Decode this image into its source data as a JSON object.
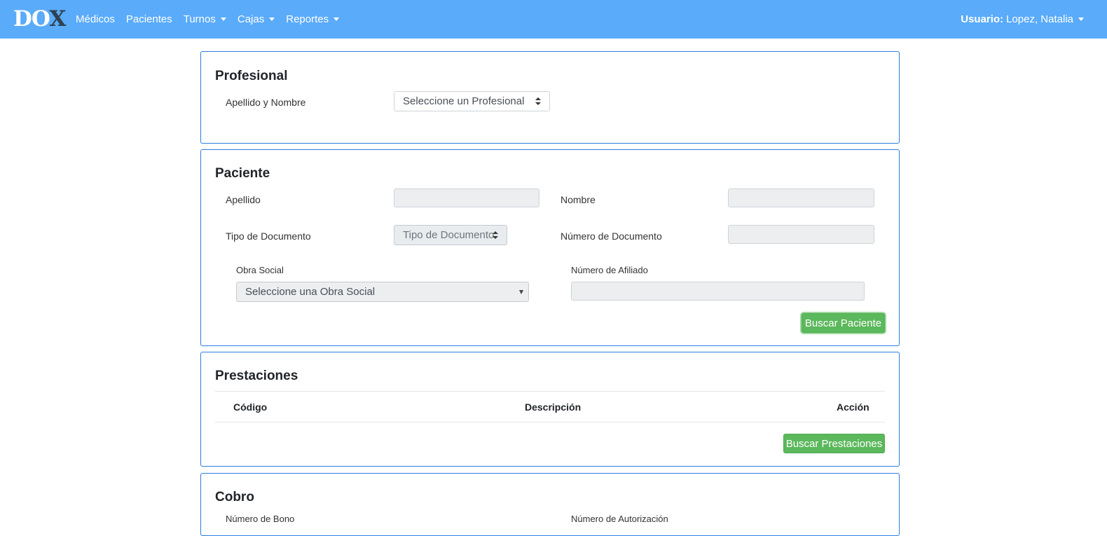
{
  "navbar": {
    "brand_main": "DO",
    "brand_x": "X",
    "items": [
      {
        "label": "Médicos"
      },
      {
        "label": "Pacientes"
      },
      {
        "label": "Turnos"
      },
      {
        "label": "Cajas"
      },
      {
        "label": "Reportes"
      }
    ],
    "user_prefix": "Usuario:",
    "user_name": "Lopez, Natalia"
  },
  "profesional": {
    "title": "Profesional",
    "name_label": "Apellido y Nombre",
    "select_value": "Seleccione un Profesional"
  },
  "paciente": {
    "title": "Paciente",
    "apellido_label": "Apellido",
    "nombre_label": "Nombre",
    "tipo_doc_label": "Tipo de Documento",
    "tipo_doc_value": "Tipo de Documento",
    "numero_doc_label": "Número de Documento",
    "obra_social_label": "Obra Social",
    "obra_social_value": "Seleccione una Obra Social",
    "afiliado_label": "Número de Afiliado",
    "buscar_button": "Buscar Paciente"
  },
  "prestaciones": {
    "title": "Prestaciones",
    "columns": [
      "Código",
      "Descripción",
      "Acción"
    ],
    "buscar_button": "Buscar Prestaciones"
  },
  "cobro": {
    "title": "Cobro",
    "bono_label": "Número de Bono",
    "autorizacion_label": "Número de Autorización"
  },
  "colors": {
    "navbar": "#5aabfa",
    "card_border": "#2b7de1",
    "button_green": "#5cb85c"
  }
}
